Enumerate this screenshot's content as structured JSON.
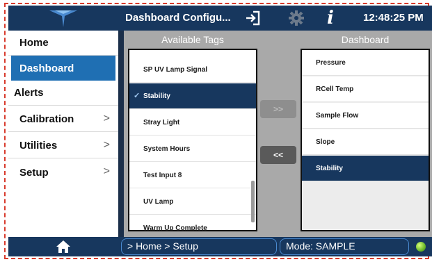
{
  "header": {
    "title": "Dashboard Configu...",
    "time": "12:48:25 PM",
    "exit_icon": "exit-icon",
    "settings_icon": "gear-icon",
    "info_icon": "info-icon"
  },
  "nav": {
    "items": [
      {
        "label": "Home",
        "active": false,
        "has_chevron": false
      },
      {
        "label": "Dashboard",
        "active": true,
        "has_chevron": false
      },
      {
        "label": "Alerts",
        "active": false,
        "has_chevron": false
      },
      {
        "label": "Calibration",
        "active": false,
        "has_chevron": true
      },
      {
        "label": "Utilities",
        "active": false,
        "has_chevron": true
      },
      {
        "label": "Setup",
        "active": false,
        "has_chevron": true
      }
    ],
    "chevron": ">"
  },
  "available": {
    "heading": "Available Tags",
    "items": [
      {
        "label": "SP UV Lamp Signal",
        "selected": false
      },
      {
        "label": "Stability",
        "selected": true
      },
      {
        "label": "Stray Light",
        "selected": false
      },
      {
        "label": "System Hours",
        "selected": false
      },
      {
        "label": "Test Input 8",
        "selected": false
      },
      {
        "label": "UV Lamp",
        "selected": false
      },
      {
        "label": "Warm Up Complete",
        "selected": false
      }
    ],
    "check": "✓"
  },
  "buttons": {
    "add_label": ">>",
    "remove_label": "<<"
  },
  "dashboard": {
    "heading": "Dashboard",
    "items": [
      {
        "label": "Pressure",
        "selected": false
      },
      {
        "label": "RCell Temp",
        "selected": false
      },
      {
        "label": "Sample Flow",
        "selected": false
      },
      {
        "label": "Slope",
        "selected": false
      },
      {
        "label": "Stability",
        "selected": true
      }
    ]
  },
  "footer": {
    "home_icon": "home-icon",
    "breadcrumb": "> Home > Setup",
    "mode": "Mode: SAMPLE",
    "status_color": "#6bb82a"
  },
  "colors": {
    "bar": "#17375e",
    "accent": "#1f6fb3",
    "frame": "#d83a2c"
  }
}
